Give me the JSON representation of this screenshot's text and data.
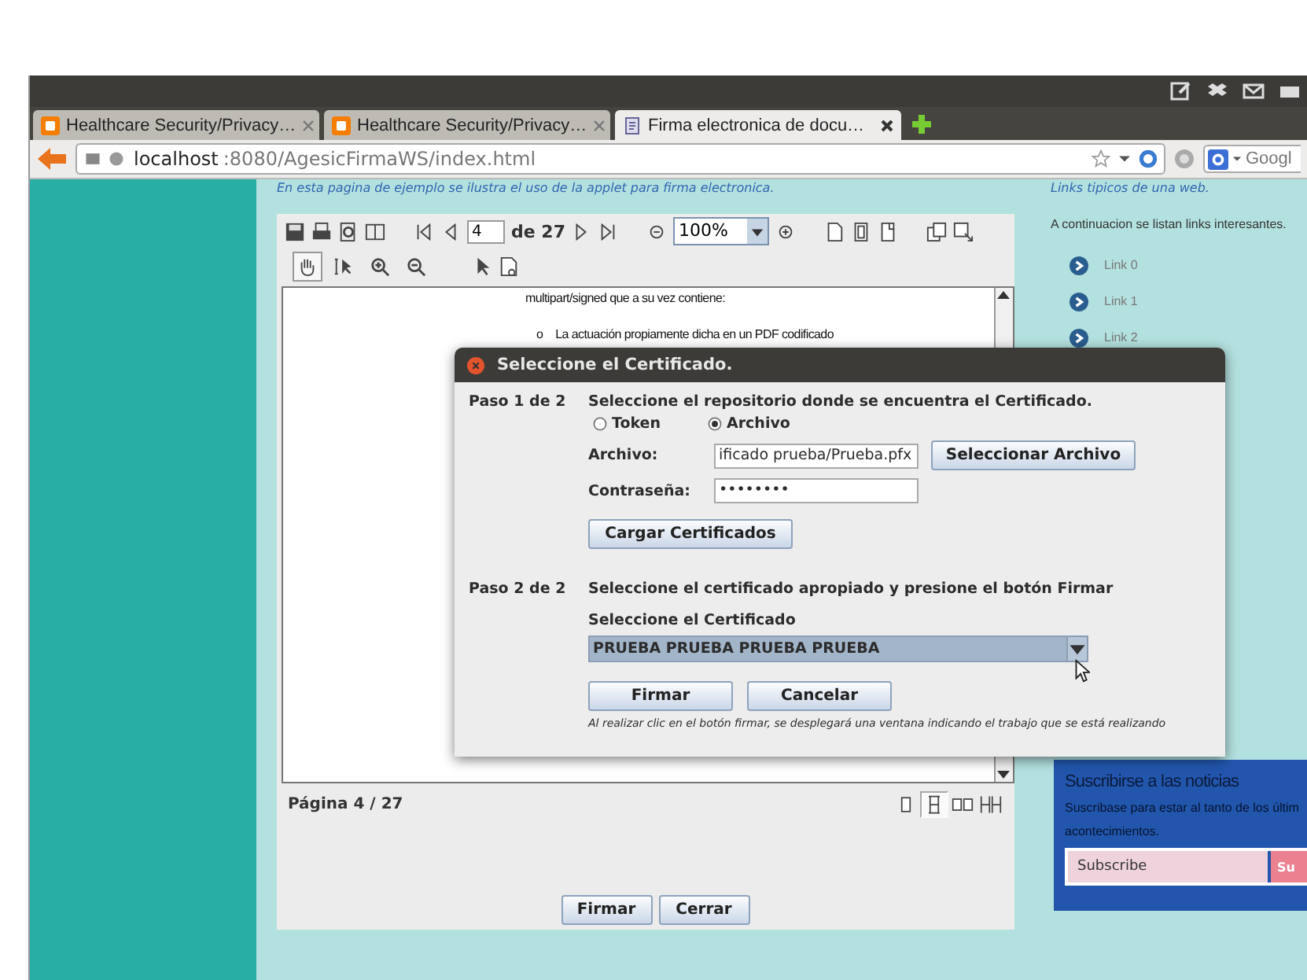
{
  "browser": {
    "tabs": [
      {
        "title": "Healthcare Security/Privacy…",
        "kind": "blog",
        "selected": false
      },
      {
        "title": "Healthcare Security/Privacy…",
        "kind": "blog",
        "selected": false
      },
      {
        "title": "Firma electronica de docu…",
        "kind": "page",
        "selected": true
      }
    ],
    "url_host": "localhost",
    "url_rest": ":8080/AgesicFirmaWS/index.html",
    "search_placeholder": "Googl"
  },
  "page": {
    "intro": "En esta pagina de ejemplo se ilustra el uso de la applet para firma electronica."
  },
  "viewer": {
    "page_input": "4",
    "page_total": "de 27",
    "zoom": "100%",
    "tools": [
      {
        "kind": "hand",
        "selected": true
      },
      {
        "kind": "text-select",
        "selected": false
      },
      {
        "kind": "zoom-in",
        "selected": false
      },
      {
        "kind": "zoom-out",
        "selected": false
      }
    ],
    "doc_lines": [
      {
        "kind": "plain",
        "text": "multipart/signed que a su vez contiene:"
      },
      {
        "kind": "bullet",
        "marker": "o",
        "text": "La actuación propiamente dicha en un PDF codificado"
      }
    ],
    "status": "Página 4 / 27",
    "view_modes": [
      {
        "kind": "single",
        "selected": false
      },
      {
        "kind": "continuous",
        "selected": true
      },
      {
        "kind": "facing",
        "selected": false
      },
      {
        "kind": "continuous-facing",
        "selected": false
      }
    ],
    "buttons": [
      "Firmar",
      "Cerrar"
    ]
  },
  "sidebar": {
    "heading": "Links tipicos de una web.",
    "intro": "A continuacion se listan links interesantes.",
    "links": [
      "Link 0",
      "Link 1",
      "Link 2"
    ]
  },
  "newsletter": {
    "title": "Suscribirse a las noticias",
    "text_lines": [
      "Suscribase para estar al tanto de los últim",
      "acontecimientos."
    ],
    "placeholder": "Subscribe",
    "button": "Su"
  },
  "dialog": {
    "title": "Seleccione el Certificado.",
    "step1_label": "Paso 1 de 2",
    "step1_text": "Seleccione el repositorio donde se encuentra el Certificado.",
    "repository_options": [
      {
        "label": "Token",
        "selected": false
      },
      {
        "label": "Archivo",
        "selected": true
      }
    ],
    "file_label": "Archivo:",
    "file_value": "ificado prueba/Prueba.pfx",
    "select_file_button": "Seleccionar Archivo",
    "password_label": "Contraseña:",
    "password_value": "••••••••",
    "load_button": "Cargar Certificados",
    "step2_label": "Paso 2 de 2",
    "step2_text": "Seleccione el certificado apropiado y presione el botón Firmar",
    "certificate_label": "Seleccione el Certificado",
    "certificate_value": "PRUEBA PRUEBA PRUEBA PRUEBA",
    "buttons": [
      "Firmar",
      "Cancelar"
    ],
    "note": "Al realizar clic en el botón firmar, se desplegará una ventana indicando el trabajo que se está realizando"
  }
}
